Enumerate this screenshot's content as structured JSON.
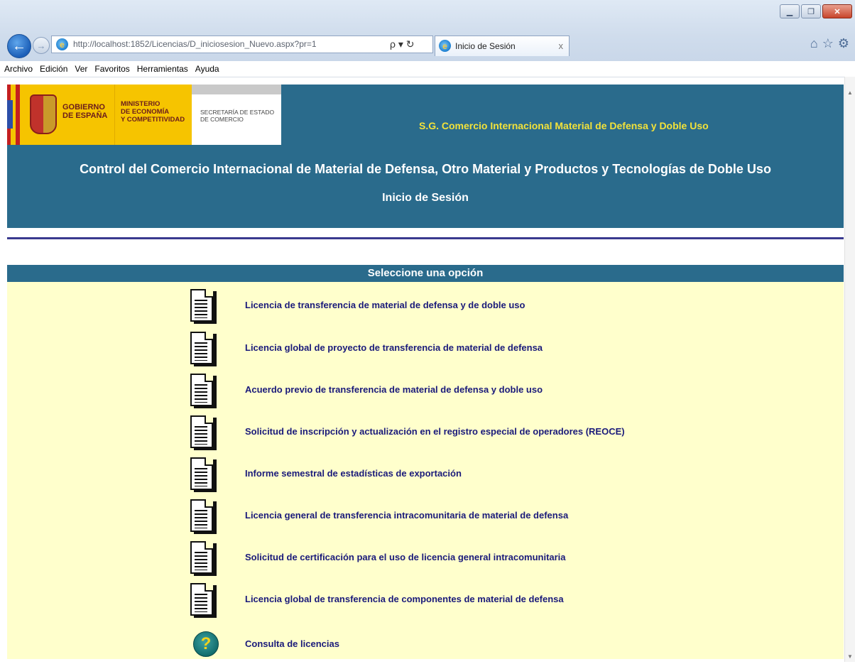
{
  "browser": {
    "url": "http://localhost:1852/Licencias/D_iniciosesion_Nuevo.aspx?pr=1",
    "tab_title": "Inicio de Sesión",
    "tab_close": "x",
    "addr_controls": "ρ ▾ ↻",
    "menu": [
      "Archivo",
      "Edición",
      "Ver",
      "Favoritos",
      "Herramientas",
      "Ayuda"
    ]
  },
  "header": {
    "gobierno": "GOBIERNO\nDE ESPAÑA",
    "ministerio": "MINISTERIO\nDE ECONOMÍA\nY COMPETITIVIDAD",
    "secretaria": "SECRETARÍA DE ESTADO\nDE COMERCIO",
    "sg_title": "S.G. Comercio Internacional Material de Defensa y Doble Uso",
    "main_title": "Control del Comercio Internacional de Material de Defensa, Otro Material y Productos y Tecnologías de Doble Uso",
    "sub_title": "Inicio de Sesión"
  },
  "options": {
    "heading": "Seleccione una opción",
    "items": [
      {
        "label": "Licencia de transferencia de material de defensa y de doble uso",
        "icon": "document-icon"
      },
      {
        "label": "Licencia global de proyecto de transferencia de material de defensa",
        "icon": "document-icon"
      },
      {
        "label": "Acuerdo previo de transferencia de material de defensa y doble uso",
        "icon": "document-icon"
      },
      {
        "label": "Solicitud de inscripción y actualización en el registro especial de operadores (REOCE)",
        "icon": "document-icon"
      },
      {
        "label": "Informe semestral de estadísticas de exportación",
        "icon": "document-icon"
      },
      {
        "label": "Licencia general de transferencia intracomunitaria de material de defensa",
        "icon": "document-icon"
      },
      {
        "label": "Solicitud de certificación para el uso de licencia general intracomunitaria",
        "icon": "document-icon"
      },
      {
        "label": "Licencia global de transferencia de componentes de material de defensa",
        "icon": "document-icon"
      },
      {
        "label": "Consulta de licencias",
        "icon": "help-icon"
      }
    ]
  },
  "colors": {
    "header_bg": "#2a6b8c",
    "panel_bg": "#ffffcc",
    "link": "#1a1a7a",
    "sg_title": "#f2e23a"
  }
}
